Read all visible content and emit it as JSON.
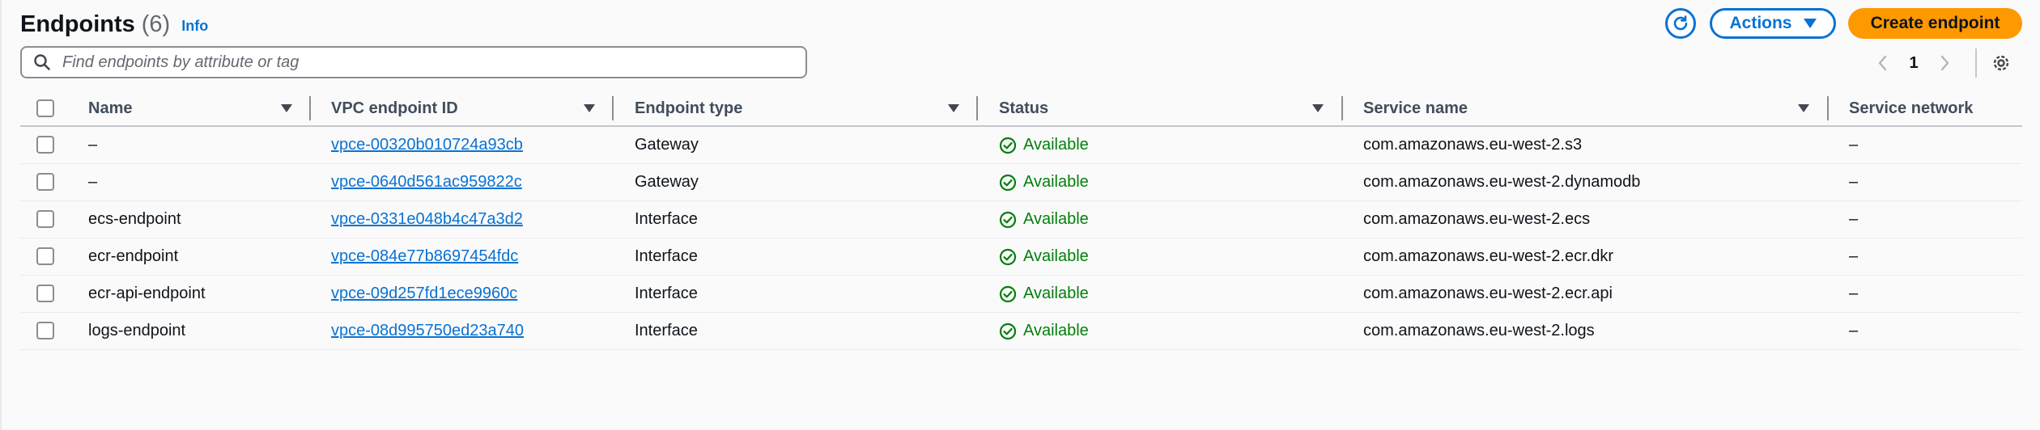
{
  "header": {
    "title": "Endpoints",
    "count": "(6)",
    "info_link": "Info"
  },
  "toolbar": {
    "refresh_icon": "refresh-icon",
    "actions_label": "Actions",
    "create_label": "Create endpoint"
  },
  "search": {
    "placeholder": "Find endpoints by attribute or tag",
    "value": ""
  },
  "pagination": {
    "current_page": "1"
  },
  "table": {
    "columns": [
      "Name",
      "VPC endpoint ID",
      "Endpoint type",
      "Status",
      "Service name",
      "Service network"
    ],
    "rows": [
      {
        "name": "–",
        "id": "vpce-00320b010724a93cb",
        "type": "Gateway",
        "status": "Available",
        "service": "com.amazonaws.eu-west-2.s3",
        "network": "–"
      },
      {
        "name": "–",
        "id": "vpce-0640d561ac959822c",
        "type": "Gateway",
        "status": "Available",
        "service": "com.amazonaws.eu-west-2.dynamodb",
        "network": "–"
      },
      {
        "name": "ecs-endpoint",
        "id": "vpce-0331e048b4c47a3d2",
        "type": "Interface",
        "status": "Available",
        "service": "com.amazonaws.eu-west-2.ecs",
        "network": "–"
      },
      {
        "name": "ecr-endpoint",
        "id": "vpce-084e77b8697454fdc",
        "type": "Interface",
        "status": "Available",
        "service": "com.amazonaws.eu-west-2.ecr.dkr",
        "network": "–"
      },
      {
        "name": "ecr-api-endpoint",
        "id": "vpce-09d257fd1ece9960c",
        "type": "Interface",
        "status": "Available",
        "service": "com.amazonaws.eu-west-2.ecr.api",
        "network": "–"
      },
      {
        "name": "logs-endpoint",
        "id": "vpce-08d995750ed23a740",
        "type": "Interface",
        "status": "Available",
        "service": "com.amazonaws.eu-west-2.logs",
        "network": "–"
      }
    ]
  },
  "colors": {
    "link": "#0972d3",
    "primary_button": "#ff9900",
    "status_success": "#037f0c"
  }
}
